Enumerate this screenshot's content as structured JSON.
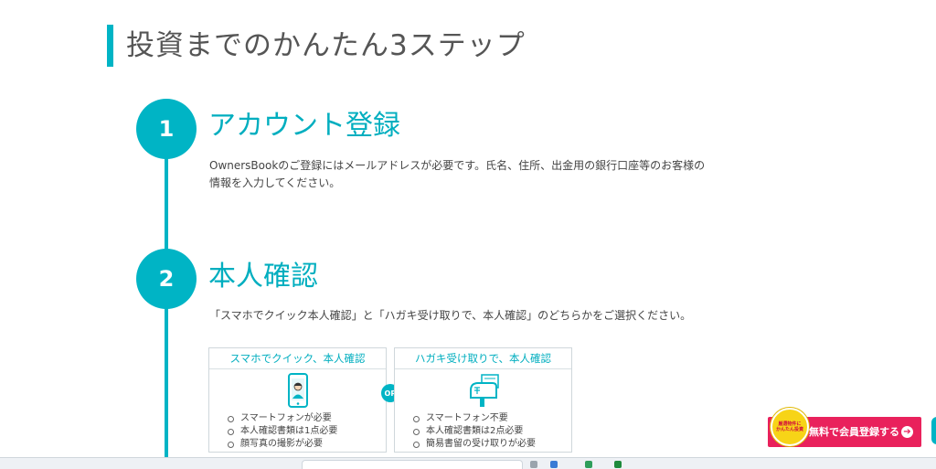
{
  "page": {
    "title": "投資までのかんたん3ステップ"
  },
  "steps": [
    {
      "number": "1",
      "title": "アカウント登録",
      "description_lines": [
        "OwnersBookのご登録にはメールアドレスが必要です。氏名、住所、出金用の銀行口座等のお客様の",
        "情報を入力してください。"
      ]
    },
    {
      "number": "2",
      "title": "本人確認",
      "description": "「スマホでクイック本人確認」と「ハガキ受け取りで、本人確認」のどちらかをご選択ください。"
    }
  ],
  "options": [
    {
      "title": "スマホでクイック、本人確認",
      "icon": "smartphone-selfie-icon",
      "items": [
        "スマートフォンが必要",
        "本人確認書類は1点必要",
        "顔写真の撮影が必要"
      ]
    },
    {
      "title": "ハガキ受け取りで、本人確認",
      "icon": "mailbox-icon",
      "items": [
        "スマートフォン不要",
        "本人確認書類は2点必要",
        "簡易書留の受け取りが必要"
      ]
    }
  ],
  "or_label": "OR",
  "cta": {
    "badge_lines": [
      "厳選物件に",
      "かんたん投資"
    ],
    "label": "無料で会員登録する",
    "arrow_icon": "arrow-right-circle-icon"
  },
  "colors": {
    "accent": "#00b4c5",
    "cta": "#e9215c",
    "badge": "#f7d417"
  }
}
